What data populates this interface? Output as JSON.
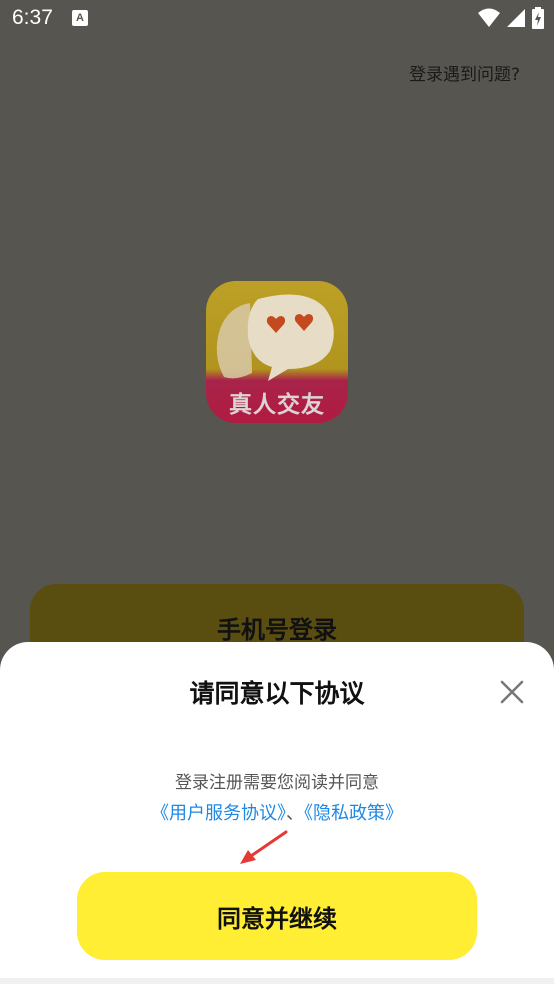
{
  "status_bar": {
    "time": "6:37",
    "notification_icon": "A",
    "icons": [
      "wifi-icon",
      "signal-icon",
      "battery-icon"
    ]
  },
  "header": {
    "help_link": "登录遇到问题?"
  },
  "logo": {
    "text": "真人交友",
    "colors": {
      "top": "#b8991f",
      "bottom": "#b11b41"
    }
  },
  "login": {
    "phone_button": "手机号登录"
  },
  "dialog": {
    "title": "请同意以下协议",
    "description": "登录注册需要您阅读并同意",
    "user_agreement_link": "《用户服务协议》",
    "separator": "、",
    "privacy_link": "《隐私政策》",
    "agree_button": "同意并继续",
    "close_icon": "close-icon",
    "annotation_icon": "red-arrow-icon"
  },
  "colors": {
    "accent_yellow": "#ffee33",
    "link_blue": "#1e88e5",
    "arrow_red": "#e53935"
  }
}
